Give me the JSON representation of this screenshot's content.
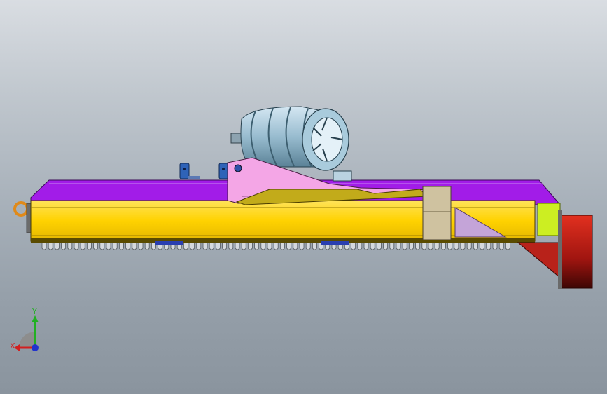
{
  "viewport": {
    "model": "mower-assembly",
    "colors": {
      "deck_top": "#a21ce8",
      "frame": "#ffd400",
      "bracket": "#f4a6e6",
      "motor": "#9fc3d6",
      "wheel": "#b8221a",
      "green_block": "#ccee22",
      "blade": "#c7cbd0"
    }
  },
  "triad": {
    "x_label": "X",
    "y_label": "Y",
    "colors": {
      "x": "#d21f1f",
      "y": "#22b022",
      "z": "#2233cc"
    }
  }
}
